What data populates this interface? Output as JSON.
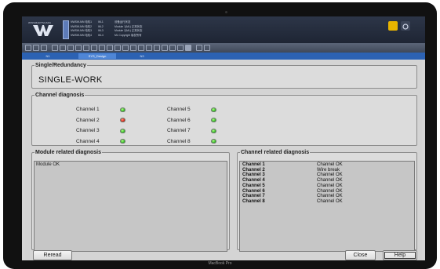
{
  "header": {
    "logo_text": "WINSMARTSCADA",
    "info_col1": [
      "NWSW-MN 电机1",
      "NWSW-MN 电机2",
      "NWSW-MN 电机3",
      "NWSW-MN 电机4"
    ],
    "info_col2": [
      "IM-1",
      "IM-2",
      "IM-3",
      "IM-4"
    ],
    "info_col3": [
      "设备运行状态",
      "Module 1(ML) 正常状态",
      "Module 2(ML) 正常状态",
      "ML Copyright 版权所有"
    ]
  },
  "tabs": [
    "N1",
    "SYS_Design",
    "N3"
  ],
  "redundancy": {
    "title": "Single/Redundancy",
    "value": "SINGLE-WORK"
  },
  "channel_diag": {
    "title": "Channel diagnosis",
    "channels": [
      {
        "label": "Channel 1",
        "status": "ok"
      },
      {
        "label": "Channel 2",
        "status": "err"
      },
      {
        "label": "Channel 3",
        "status": "ok"
      },
      {
        "label": "Channel 4",
        "status": "ok"
      },
      {
        "label": "Channel 5",
        "status": "ok"
      },
      {
        "label": "Channel 6",
        "status": "ok"
      },
      {
        "label": "Channel 7",
        "status": "ok"
      },
      {
        "label": "Channel 8",
        "status": "ok"
      }
    ]
  },
  "module_diag": {
    "title": "Module related diagnosis",
    "text": "Module OK"
  },
  "channel_related": {
    "title": "Channel related diagnosis",
    "rows": [
      {
        "name": "Channel 1",
        "state": "Channel OK"
      },
      {
        "name": "Channel 2",
        "state": "Wire break"
      },
      {
        "name": "Channel 3",
        "state": "Channel OK"
      },
      {
        "name": "Channel 4",
        "state": "Channel OK"
      },
      {
        "name": "Channel 5",
        "state": "Channel OK"
      },
      {
        "name": "Channel 6",
        "state": "Channel OK"
      },
      {
        "name": "Channel 7",
        "state": "Channel OK"
      },
      {
        "name": "Channel 8",
        "state": "Channel OK"
      }
    ]
  },
  "buttons": {
    "reread": "Reread",
    "close": "Close",
    "help": "Help"
  },
  "device_label": "MacBook Pro"
}
